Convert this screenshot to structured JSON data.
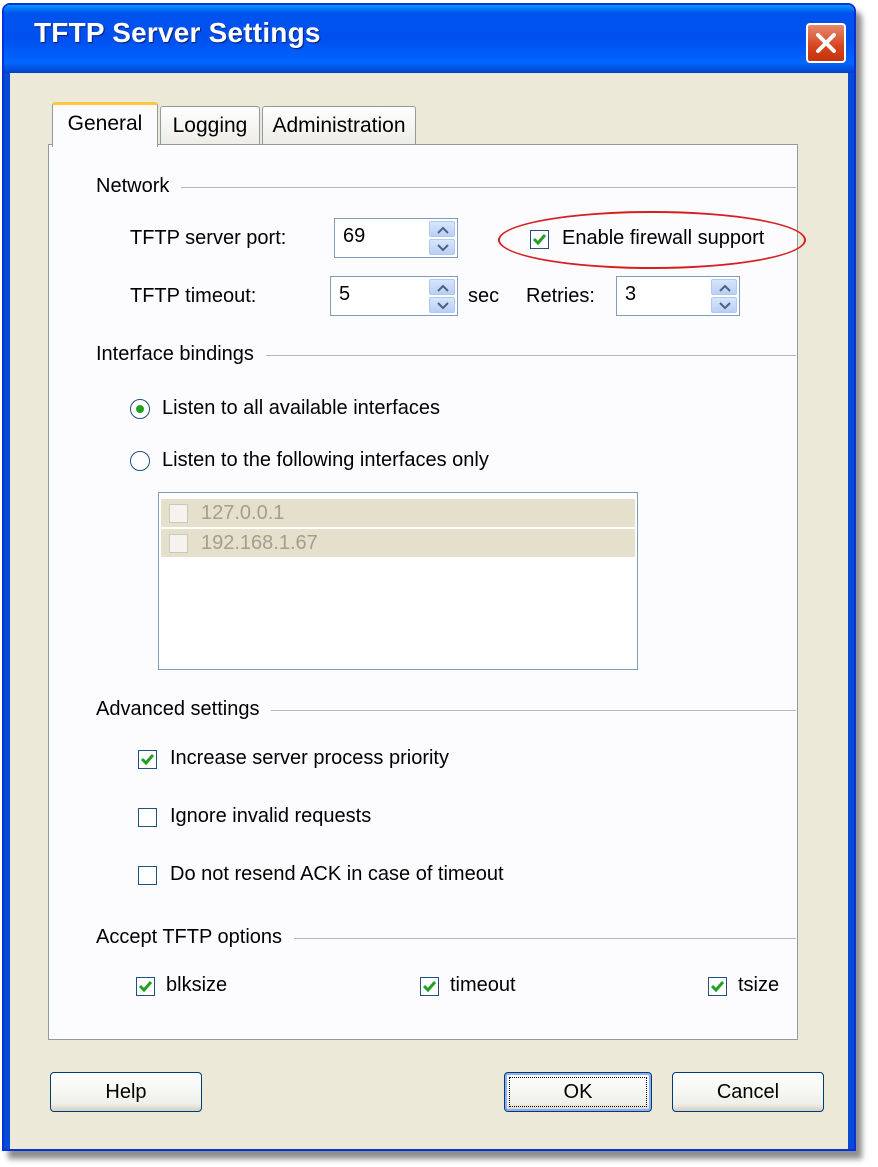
{
  "window": {
    "title": "TFTP Server Settings"
  },
  "tabs": [
    {
      "label": "General",
      "active": true
    },
    {
      "label": "Logging",
      "active": false
    },
    {
      "label": "Administration",
      "active": false
    }
  ],
  "network": {
    "group_label": "Network",
    "port_label": "TFTP server port:",
    "port_value": "69",
    "firewall_label": "Enable firewall support",
    "firewall_checked": true,
    "timeout_label": "TFTP timeout:",
    "timeout_value": "5",
    "timeout_unit": "sec",
    "retries_label": "Retries:",
    "retries_value": "3"
  },
  "interfaces": {
    "group_label": "Interface bindings",
    "options": [
      {
        "label": "Listen to all available interfaces",
        "selected": true
      },
      {
        "label": "Listen to the following interfaces only",
        "selected": false
      }
    ],
    "list": [
      {
        "label": "127.0.0.1",
        "checked": false
      },
      {
        "label": "192.168.1.67",
        "checked": false
      }
    ]
  },
  "advanced": {
    "group_label": "Advanced settings",
    "options": [
      {
        "label": "Increase server process priority",
        "checked": true
      },
      {
        "label": "Ignore invalid requests",
        "checked": false
      },
      {
        "label": "Do not resend ACK in case of timeout",
        "checked": false
      }
    ]
  },
  "accept": {
    "group_label": "Accept TFTP options",
    "options": [
      {
        "label": "blksize",
        "checked": true
      },
      {
        "label": "timeout",
        "checked": true
      },
      {
        "label": "tsize",
        "checked": true
      }
    ]
  },
  "buttons": {
    "help": "Help",
    "ok": "OK",
    "cancel": "Cancel"
  },
  "colors": {
    "title_bar": "#0053ee",
    "dialog_bg": "#ece9d8",
    "highlight_ellipse": "#d51f1f",
    "check_green": "#21a121"
  }
}
